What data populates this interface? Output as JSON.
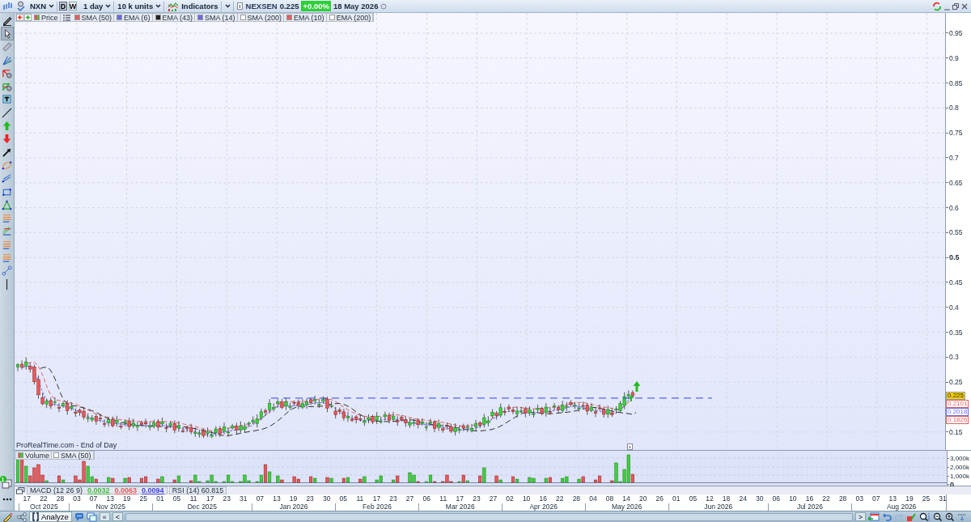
{
  "toolbar": {
    "symbol": "NXN",
    "periods": [
      {
        "label": "D",
        "selected": true
      },
      {
        "label": "W",
        "selected": false
      }
    ],
    "interval": "1 day",
    "units": "10 k units",
    "indicators": "Indicators",
    "name": "NEXSEN",
    "price": "0.225",
    "change": "+0.00%",
    "date": "18 May 2026"
  },
  "tools": [
    {
      "kind": "pencil",
      "selected": false
    },
    {
      "kind": "cursor",
      "selected": true
    },
    {
      "kind": "ruler",
      "selected": false
    },
    {
      "kind": "fan",
      "selected": false
    },
    {
      "kind": "fib-arc",
      "selected": false
    },
    {
      "kind": "fib-fan",
      "selected": false
    },
    {
      "kind": "text",
      "selected": false
    },
    {
      "kind": "line",
      "selected": false
    },
    {
      "kind": "arrow-up",
      "selected": false
    },
    {
      "kind": "arrow-down",
      "selected": false
    },
    {
      "kind": "arrow",
      "selected": false
    },
    {
      "kind": "ellipse",
      "selected": false
    },
    {
      "kind": "channel",
      "selected": false
    },
    {
      "kind": "rectangle",
      "selected": false
    },
    {
      "kind": "triangle",
      "selected": false
    },
    {
      "kind": "levels",
      "selected": false
    },
    {
      "kind": "fib-levels",
      "selected": false
    },
    {
      "kind": "levels",
      "selected": false
    },
    {
      "kind": "levels",
      "selected": false
    },
    {
      "kind": "link",
      "selected": false
    },
    {
      "kind": "vertical-line",
      "selected": false
    }
  ],
  "legend": [
    {
      "label": "Price",
      "kind": "price"
    },
    {
      "label": "SMA (50)",
      "kind": "line",
      "color": "#e06060"
    },
    {
      "label": "EMA (6)",
      "kind": "line",
      "color": "#6a6ae8"
    },
    {
      "label": "EMA (43)",
      "kind": "line",
      "color": "#222222"
    },
    {
      "label": "SMA (14)",
      "kind": "line",
      "color": "#6a6ae8"
    },
    {
      "label": "SMA (200)",
      "kind": "line",
      "color": "#ffffff"
    },
    {
      "label": "EMA (10)",
      "kind": "line",
      "color": "#e06060"
    },
    {
      "label": "EMA (200)",
      "kind": "line",
      "color": "#ffffff"
    }
  ],
  "price_axis": {
    "upper": [
      {
        "label": "0.95",
        "major": false
      },
      {
        "label": "0.9",
        "major": false
      },
      {
        "label": "0.85",
        "major": false
      },
      {
        "label": "0.8",
        "major": false
      },
      {
        "label": "0.75",
        "major": false
      },
      {
        "label": "0.7",
        "major": false
      },
      {
        "label": "0.65",
        "major": false
      },
      {
        "label": "0.6",
        "major": false
      },
      {
        "label": "0.55",
        "major": false
      },
      {
        "label": "0.5",
        "major": true
      },
      {
        "label": "0.45",
        "major": false
      },
      {
        "label": "0.4",
        "major": false
      },
      {
        "label": "0.35",
        "major": false
      },
      {
        "label": "0.3",
        "major": false
      },
      {
        "label": "0.25",
        "major": false
      }
    ],
    "lower": [
      {
        "label": "0.15",
        "major": false
      }
    ]
  },
  "markers": [
    {
      "label": "0.225",
      "color": "#f2d000"
    },
    {
      "label": "0.2101",
      "color": "#e06060"
    },
    {
      "label": "0.2018",
      "color": "#6a6ae8"
    },
    {
      "label": "0.1826",
      "color": "#e06060"
    }
  ],
  "source": "ProRealTime.com - End of Day",
  "volume": {
    "legend": [
      {
        "label": "Volume",
        "kind": "volume"
      },
      {
        "label": "SMA (50)",
        "kind": "line",
        "color": "#ffffff"
      }
    ],
    "axis": [
      {
        "label": "3,000k",
        "major": false
      },
      {
        "label": "2,000k",
        "major": false
      },
      {
        "label": "1,000k",
        "major": false
      },
      {
        "label": "0",
        "major": true
      }
    ]
  },
  "macd": {
    "label": "MACD (12 26 9)",
    "values": [
      {
        "text": "0.0032",
        "color": "#44bb44"
      },
      {
        "text": "0.0063",
        "color": "#e06060"
      },
      {
        "text": "0.0094",
        "color": "#4444dd"
      }
    ]
  },
  "rsi": "RSI (14) 60.815",
  "layers_badge": "1",
  "months": [
    {
      "label": "Oct 2025",
      "days": [
        "17",
        "22",
        "28"
      ]
    },
    {
      "label": "Nov 2025",
      "days": [
        "03",
        "07",
        "13",
        "19",
        "25"
      ]
    },
    {
      "label": "Dec 2025",
      "days": [
        "01",
        "05",
        "11",
        "17",
        "23",
        "31"
      ]
    },
    {
      "label": "Jan 2026",
      "days": [
        "07",
        "13",
        "19",
        "23",
        "30"
      ]
    },
    {
      "label": "Feb 2026",
      "days": [
        "05",
        "11",
        "17",
        "23",
        "27"
      ]
    },
    {
      "label": "Mar 2026",
      "days": [
        "06",
        "11",
        "17",
        "23",
        "27"
      ]
    },
    {
      "label": "Apr 2026",
      "days": [
        "02",
        "10",
        "16",
        "22",
        "28"
      ]
    },
    {
      "label": "May 2026",
      "days": [
        "04",
        "08",
        "14",
        "20",
        "26"
      ]
    },
    {
      "label": "Jun 2026",
      "days": [
        "01",
        "05",
        "12",
        "18",
        "24",
        "30"
      ]
    },
    {
      "label": "Jul 2026",
      "days": [
        "06",
        "10",
        "16",
        "22",
        "28"
      ]
    },
    {
      "label": "Aug 2026",
      "days": [
        "03",
        "07",
        "13",
        "19",
        "25",
        "31"
      ]
    }
  ],
  "bottom_bar": {
    "analyze": "Analyze",
    "first": "«",
    "prev": "<",
    "next": ">"
  }
}
